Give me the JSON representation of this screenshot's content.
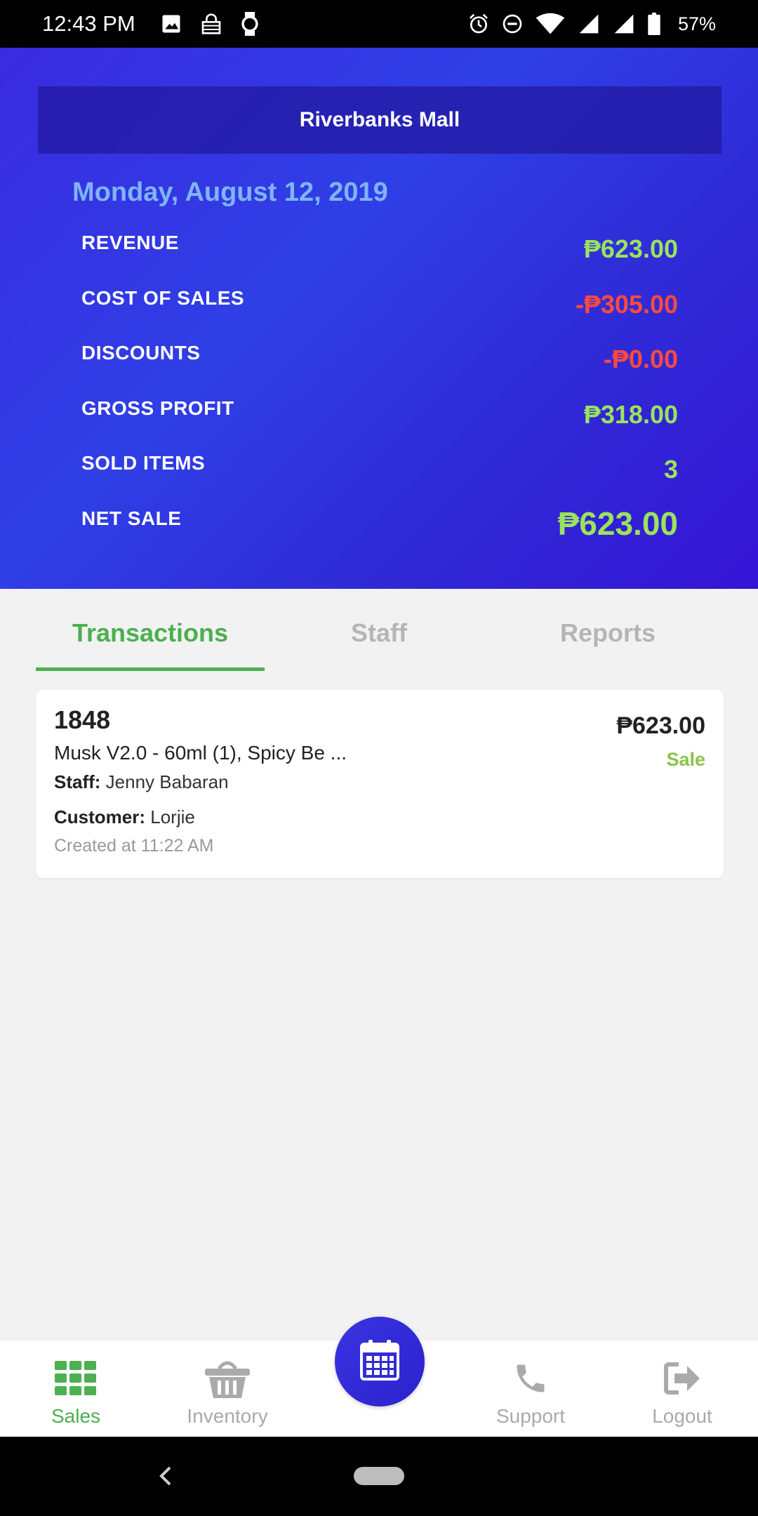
{
  "status_bar": {
    "time": "12:43 PM",
    "battery": "57%",
    "left_icons": [
      "image-icon",
      "vpn-icon",
      "watch-icon"
    ],
    "right_icons": [
      "alarm-icon",
      "dnd-icon",
      "wifi-icon",
      "signal-icon",
      "signal-icon",
      "battery-icon"
    ]
  },
  "header": {
    "store": "Riverbanks Mall",
    "date": "Monday, August 12, 2019",
    "metrics": [
      {
        "label": "REVENUE",
        "value": "₱623.00",
        "color": "#9be35a"
      },
      {
        "label": "COST OF SALES",
        "value": "-₱305.00",
        "color": "#ff4a3d"
      },
      {
        "label": "DISCOUNTS",
        "value": "-₱0.00",
        "color": "#ff4a3d"
      },
      {
        "label": "GROSS PROFIT",
        "value": "₱318.00",
        "color": "#9be35a"
      },
      {
        "label": "SOLD ITEMS",
        "value": "3",
        "color": "#9be35a"
      },
      {
        "label": "NET SALE",
        "value": "₱623.00",
        "color": "#9be35a"
      }
    ]
  },
  "tabs": [
    {
      "label": "Transactions",
      "active": true
    },
    {
      "label": "Staff",
      "active": false
    },
    {
      "label": "Reports",
      "active": false
    }
  ],
  "transactions": [
    {
      "id": "1848",
      "items": "Musk V2.0 - 60ml (1), Spicy Be ...",
      "staff_label": "Staff:",
      "staff": "Jenny Babaran",
      "customer_label": "Customer:",
      "customer": "Lorjie",
      "created": "Created at 11:22 AM",
      "amount": "₱623.00",
      "type": "Sale"
    }
  ],
  "bottom_nav": {
    "items": [
      {
        "label": "Sales",
        "icon": "grid-icon",
        "active": true
      },
      {
        "label": "Inventory",
        "icon": "basket-icon",
        "active": false
      },
      {
        "label": "Support",
        "icon": "phone-icon",
        "active": false
      },
      {
        "label": "Logout",
        "icon": "logout-icon",
        "active": false
      }
    ],
    "fab_icon": "calendar-icon"
  },
  "colors": {
    "accent_green": "#4caf50",
    "header_blue": "#2f3fe6",
    "positive": "#9be35a",
    "negative": "#ff4a3d"
  }
}
